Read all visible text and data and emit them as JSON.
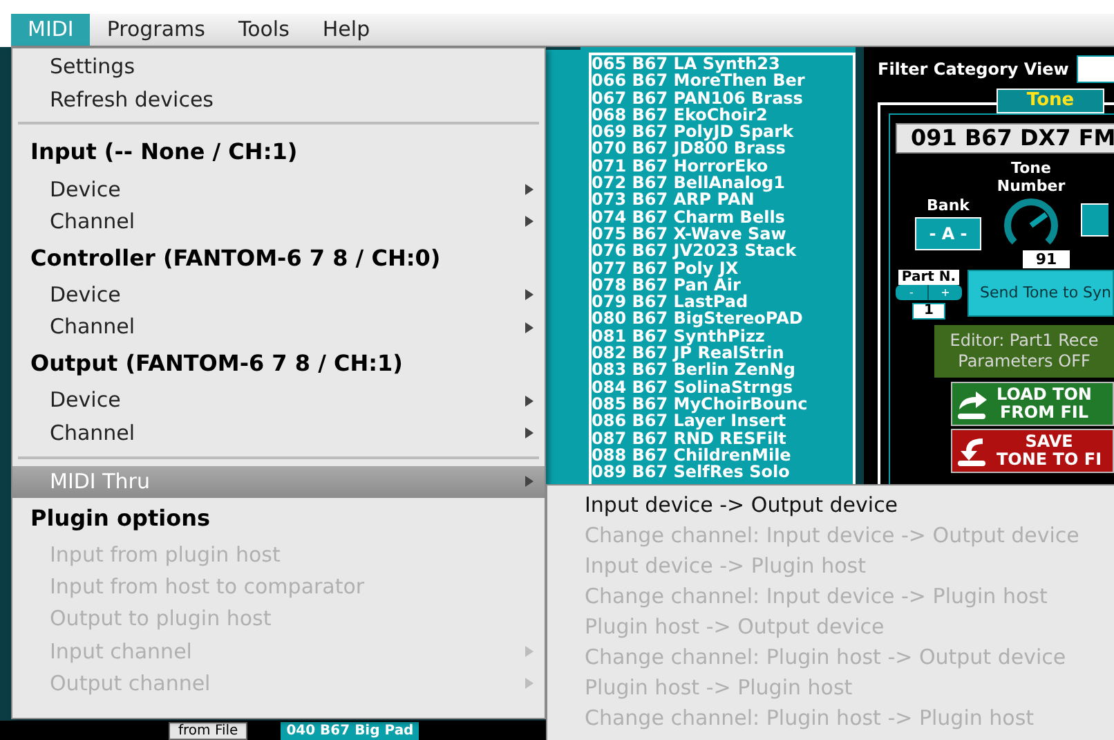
{
  "menubar": [
    {
      "label": "MIDI",
      "selected": true
    },
    {
      "label": "Programs",
      "selected": false
    },
    {
      "label": "Tools",
      "selected": false
    },
    {
      "label": "Help",
      "selected": false
    }
  ],
  "menu": {
    "items": [
      {
        "kind": "item",
        "label": "Settings",
        "disabled": false,
        "selected": false
      },
      {
        "kind": "item",
        "label": "Refresh devices",
        "disabled": false,
        "selected": false
      },
      {
        "kind": "separator"
      },
      {
        "kind": "header",
        "label": "Input (-- None / CH:1)"
      },
      {
        "kind": "submenu",
        "label": "Device",
        "disabled": false,
        "selected": false
      },
      {
        "kind": "submenu",
        "label": "Channel",
        "disabled": false,
        "selected": false
      },
      {
        "kind": "header",
        "label": "Controller (FANTOM-6 7 8 / CH:0)"
      },
      {
        "kind": "submenu",
        "label": "Device",
        "disabled": false,
        "selected": false
      },
      {
        "kind": "submenu",
        "label": "Channel",
        "disabled": false,
        "selected": false
      },
      {
        "kind": "header",
        "label": "Output  (FANTOM-6 7 8 / CH:1)"
      },
      {
        "kind": "submenu",
        "label": "Device",
        "disabled": false,
        "selected": false
      },
      {
        "kind": "submenu",
        "label": "Channel",
        "disabled": false,
        "selected": false
      },
      {
        "kind": "separator"
      },
      {
        "kind": "submenu",
        "label": "MIDI Thru",
        "disabled": false,
        "selected": true
      },
      {
        "kind": "header",
        "label": "Plugin options"
      },
      {
        "kind": "item",
        "label": "Input from plugin host",
        "disabled": true,
        "selected": false
      },
      {
        "kind": "item",
        "label": "Input from host to comparator",
        "disabled": true,
        "selected": false
      },
      {
        "kind": "item",
        "label": "Output to plugin host",
        "disabled": true,
        "selected": false
      },
      {
        "kind": "submenu",
        "label": "Input channel",
        "disabled": true,
        "selected": false
      },
      {
        "kind": "submenu",
        "label": "Output channel",
        "disabled": true,
        "selected": false
      }
    ]
  },
  "submenu": {
    "items": [
      {
        "label": "Input device -> Output device",
        "disabled": false
      },
      {
        "label": "Change channel: Input device -> Output device",
        "disabled": true
      },
      {
        "label": "Input device -> Plugin host",
        "disabled": true
      },
      {
        "label": "Change channel: Input device -> Plugin host",
        "disabled": true
      },
      {
        "label": "Plugin host -> Output device",
        "disabled": true
      },
      {
        "label": "Change channel: Plugin host -> Output device",
        "disabled": true
      },
      {
        "label": "Plugin host -> Plugin host",
        "disabled": true
      },
      {
        "label": "Change channel: Plugin host -> Plugin host",
        "disabled": true
      }
    ]
  },
  "presets": [
    "065 B67 LA Synth23",
    "066 B67 MoreThen Ber",
    "067 B67 PAN106 Brass",
    "068 B67 EkoChoir2",
    "069 B67 PolyJD Spark",
    "070 B67 JD800 Brass",
    "071 B67 HorrorEko",
    "072 B67 BellAnalog1",
    "073 B67 ARP PAN",
    "074 B67 Charm Bells",
    "075 B67 X-Wave Saw",
    "076 B67 JV2023 Stack",
    "077 B67 Poly JX",
    "078 B67 Pan Air",
    "079 B67 LastPad",
    "080 B67 BigStereoPAD",
    "081 B67 SynthPizz",
    "082 B67 JP RealStrin",
    "083 B67 Berlin ZenNg",
    "084 B67 SolinaStrngs",
    "085 B67 MyChoirBounc",
    "086 B67 Layer Insert",
    "087 B67 RND RESFilt",
    "088 B67 ChildrenMile",
    "089 B67 SelfRes Solo"
  ],
  "bottom": {
    "file_button": "from File",
    "preset": "040 B67 Big Pad"
  },
  "tone_panel": {
    "filter_label": "Filter Category View",
    "tab": "Tone",
    "display": "091 B67 DX7 FM",
    "bank_label": "Bank",
    "bank_value": "- A -",
    "number_label": "Tone Number",
    "number_value": "91",
    "part_label": "Part N.",
    "part_minus": "-",
    "part_plus": "+",
    "part_value": "1",
    "send_button": "Send Tone to Syn",
    "editor_status": [
      "Editor: Part1 Rece",
      "Parameters OFF"
    ],
    "load_button": [
      "LOAD TON",
      "FROM FIL"
    ],
    "save_button": [
      "SAVE",
      "TONE TO FI"
    ]
  }
}
